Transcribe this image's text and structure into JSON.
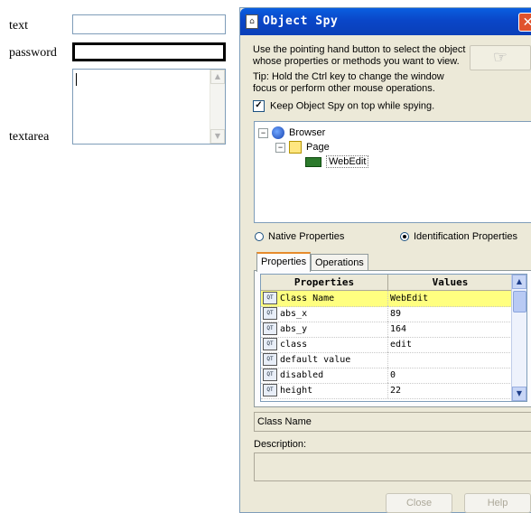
{
  "web_form": {
    "text_label": "text",
    "password_label": "password",
    "textarea_label": "textarea"
  },
  "object_spy": {
    "title": "Object Spy",
    "instructions": "Use the pointing hand button to select the object whose properties or methods you want to view.",
    "tip": "Tip: Hold the Ctrl key to change the window focus or perform other mouse operations.",
    "keep_on_top_label": "Keep Object Spy on top while spying.",
    "keep_on_top_checked": true,
    "tree": [
      {
        "label": "Browser",
        "icon": "browser-icon",
        "expander": "−"
      },
      {
        "label": "Page",
        "icon": "page-icon",
        "expander": "−"
      },
      {
        "label": "WebEdit",
        "icon": "webedit-icon",
        "selected": true
      }
    ],
    "radio_native_label": "Native Properties",
    "radio_identification_label": "Identification Properties",
    "selected_radio": "identification",
    "tabs": [
      {
        "label": "Properties",
        "active": true
      },
      {
        "label": "Operations",
        "active": false
      }
    ],
    "grid": {
      "col_properties": "Properties",
      "col_values": "Values",
      "rows": [
        {
          "property": "Class Name",
          "value": "WebEdit",
          "selected": true
        },
        {
          "property": "abs_x",
          "value": "89"
        },
        {
          "property": "abs_y",
          "value": "164"
        },
        {
          "property": "class",
          "value": "edit"
        },
        {
          "property": "default value",
          "value": ""
        },
        {
          "property": "disabled",
          "value": "0"
        },
        {
          "property": "height",
          "value": "22"
        }
      ]
    },
    "selected_property_name": "Class Name",
    "description_label": "Description:",
    "close_label": "Close",
    "help_label": "Help"
  },
  "colors": {
    "titlebar": "#0a46c8",
    "dialog_bg": "#ece9d8",
    "selected_row": "#ffff80",
    "input_border": "#7f9db9"
  }
}
